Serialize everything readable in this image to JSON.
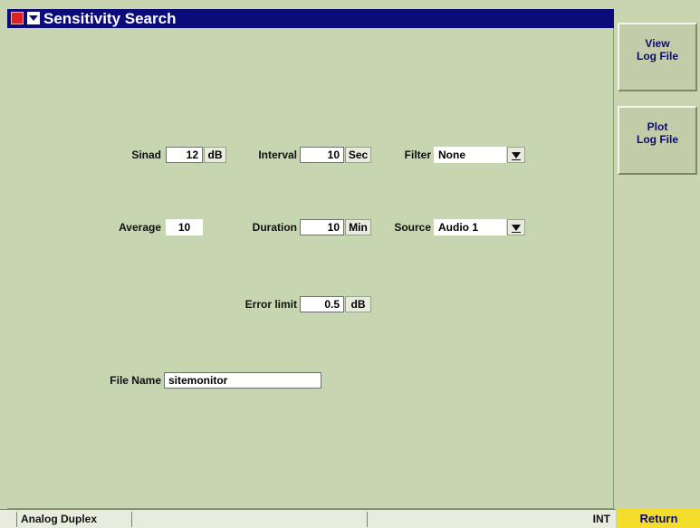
{
  "window": {
    "title": "Sensitivity Search"
  },
  "form": {
    "sinad": {
      "label": "Sinad",
      "value": "12",
      "unit": "dB"
    },
    "interval": {
      "label": "Interval",
      "value": "10",
      "unit": "Sec"
    },
    "filter": {
      "label": "Filter",
      "value": "None"
    },
    "average": {
      "label": "Average",
      "value": "10"
    },
    "duration": {
      "label": "Duration",
      "value": "10",
      "unit": "Min"
    },
    "source": {
      "label": "Source",
      "value": "Audio 1"
    },
    "error_limit": {
      "label": "Error limit",
      "value": "0.5",
      "unit": "dB"
    },
    "file_name": {
      "label": "File Name",
      "value": "sitemonitor"
    }
  },
  "softkeys": {
    "view_log": {
      "line1": "View",
      "line2": "Log File"
    },
    "plot_log": {
      "line1": "Plot",
      "line2": "Log File"
    },
    "return": "Return"
  },
  "status": {
    "mode": "Analog Duplex",
    "ref": "INT"
  },
  "colors": {
    "background": "#c9d5b0",
    "title_bar": "#0b0b7a",
    "softkey_text": "#0c0c6b",
    "return_button": "#f3dc2a"
  },
  "icons": {
    "system": "system-menu-icon",
    "dropdown": "dropdown-arrow-icon"
  }
}
